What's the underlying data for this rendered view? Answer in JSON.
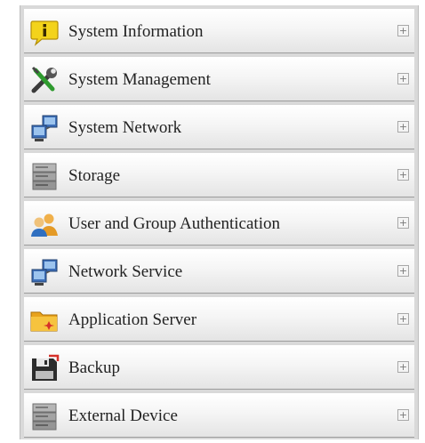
{
  "menu": {
    "expand_symbol": "+",
    "items": [
      {
        "label": "System Information",
        "icon": "info-icon"
      },
      {
        "label": "System Management",
        "icon": "tools-icon"
      },
      {
        "label": "System Network",
        "icon": "network-icon"
      },
      {
        "label": "Storage",
        "icon": "storage-icon"
      },
      {
        "label": "User and Group Authentication",
        "icon": "users-icon"
      },
      {
        "label": "Network Service",
        "icon": "network-service-icon"
      },
      {
        "label": "Application Server",
        "icon": "folder-icon"
      },
      {
        "label": "Backup",
        "icon": "backup-icon"
      },
      {
        "label": "External Device",
        "icon": "external-device-icon"
      }
    ]
  }
}
